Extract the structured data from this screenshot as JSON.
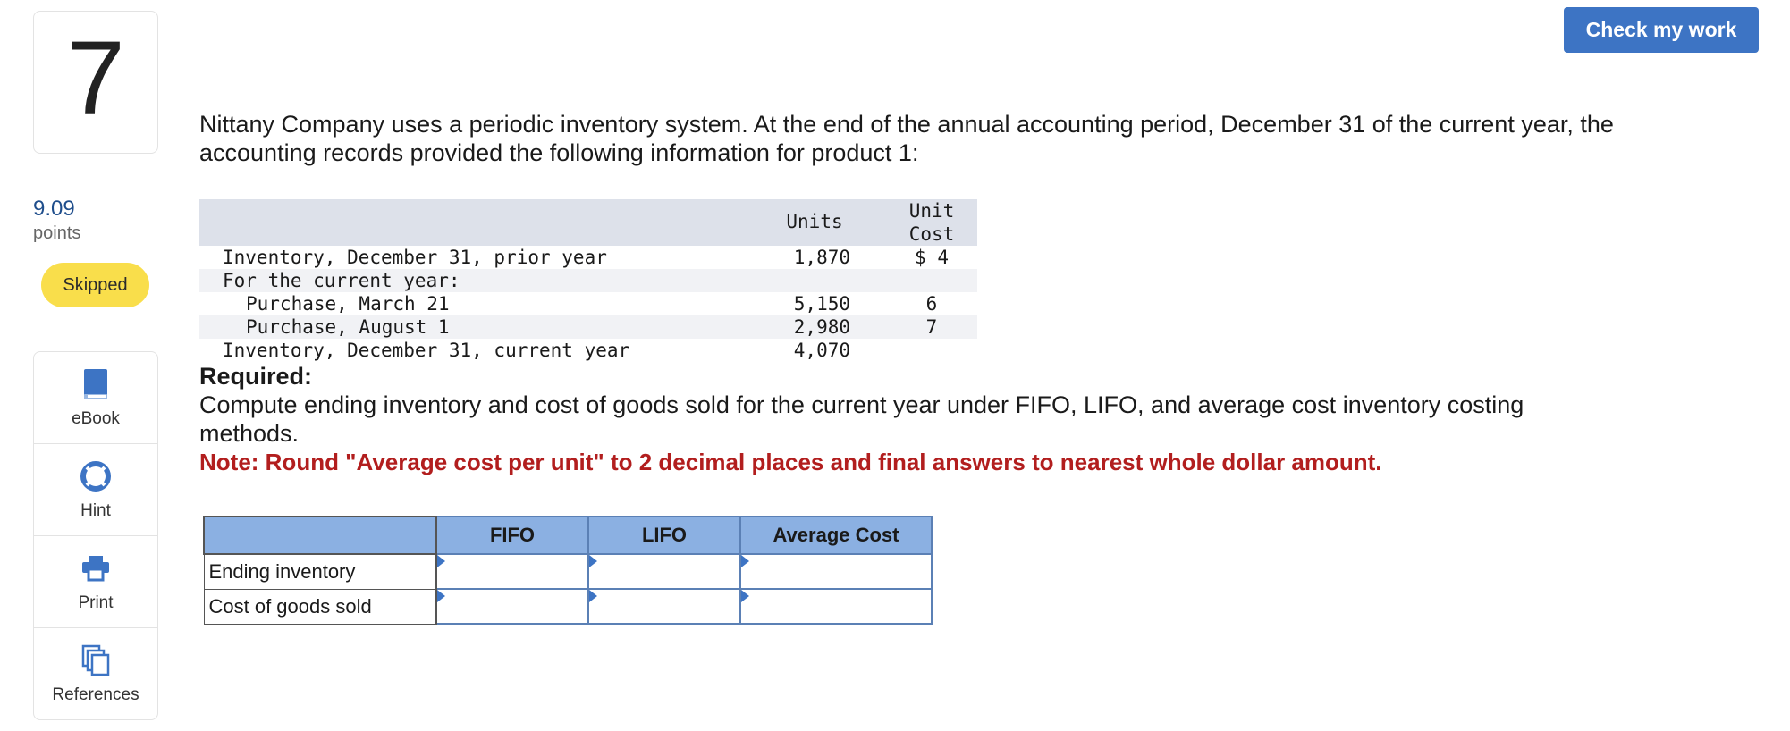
{
  "question": {
    "number": "7",
    "points_value": "9.09",
    "points_label": "points",
    "status": "Skipped"
  },
  "tools": [
    {
      "label": "eBook",
      "icon": "book-icon"
    },
    {
      "label": "Hint",
      "icon": "lifebuoy-icon"
    },
    {
      "label": "Print",
      "icon": "printer-icon"
    },
    {
      "label": "References",
      "icon": "copy-icon"
    }
  ],
  "header": {
    "check_button": "Check my work"
  },
  "problem": {
    "intro": "Nittany Company uses a periodic inventory system. At the end of the annual accounting period, December 31 of the current year, the accounting records provided the following information for product 1:",
    "table": {
      "col_units": "Units",
      "col_cost_line1": "Unit",
      "col_cost_line2": "Cost",
      "rows": [
        {
          "label": "Inventory, December 31, prior year",
          "units": "1,870",
          "cost": "$ 4"
        },
        {
          "label": "For the current year:",
          "units": "",
          "cost": ""
        },
        {
          "label": "Purchase, March 21",
          "units": "5,150",
          "cost": "6"
        },
        {
          "label": "Purchase, August 1",
          "units": "2,980",
          "cost": "7"
        },
        {
          "label": "Inventory, December 31, current year",
          "units": "4,070",
          "cost": ""
        }
      ]
    },
    "required_heading": "Required:",
    "required_text": "Compute ending inventory and cost of goods sold for the current year under FIFO, LIFO, and average cost inventory costing methods.",
    "note": "Note: Round \"Average cost per unit\" to 2 decimal places and final answers to nearest whole dollar amount."
  },
  "answer_table": {
    "headers": [
      "FIFO",
      "LIFO",
      "Average Cost"
    ],
    "rows": [
      {
        "label": "Ending inventory",
        "values": [
          "",
          "",
          ""
        ]
      },
      {
        "label": "Cost of goods sold",
        "values": [
          "",
          "",
          ""
        ]
      }
    ]
  },
  "colors": {
    "accent": "#3d74c4",
    "status_skipped": "#f9de4b",
    "note_red": "#b21e1e",
    "table_header": "#8bb0e2"
  }
}
